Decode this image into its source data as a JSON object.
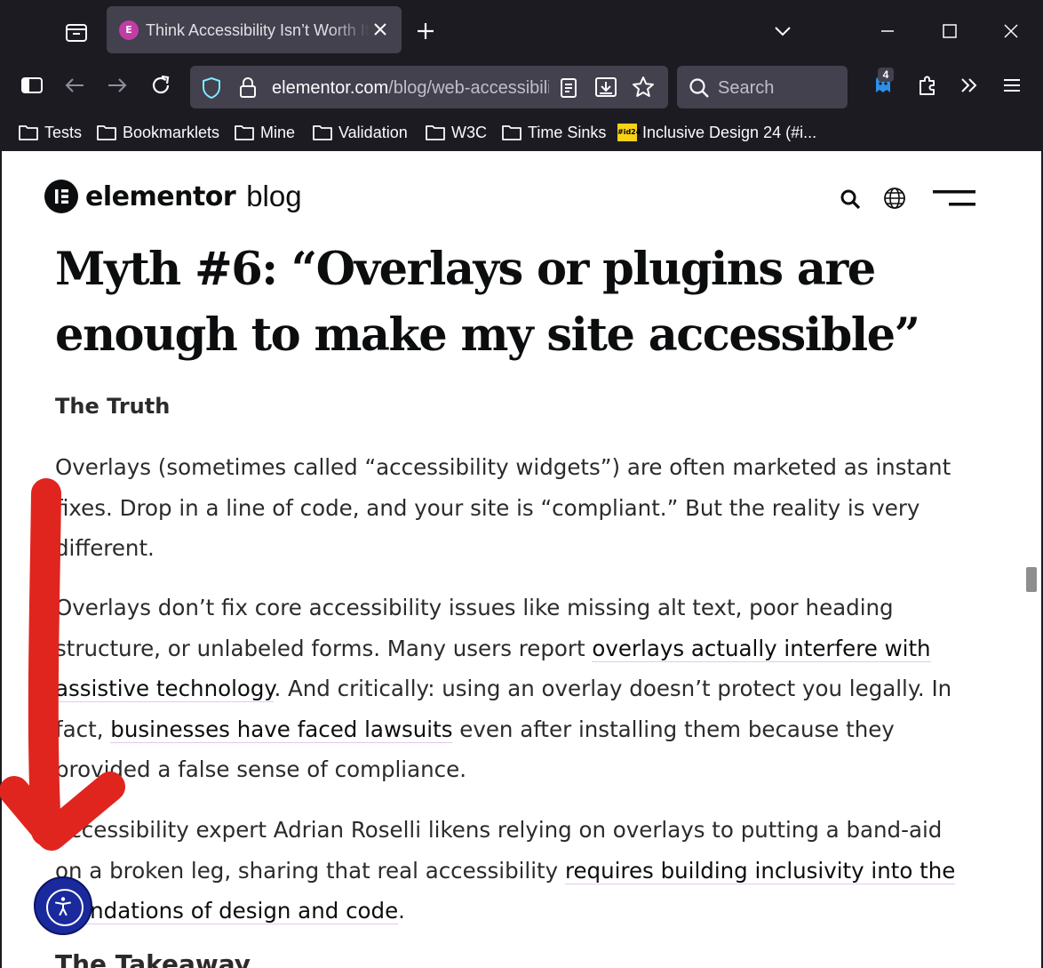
{
  "browser": {
    "tab": {
      "title": "Think Accessibility Isn’t Worth It? Here’s Why You’re Wrong",
      "favicon_glyph": "E"
    },
    "url": {
      "host": "elementor.com",
      "path": "/blog/web-accessibility"
    },
    "search_placeholder": "Search",
    "extension_badge": "4",
    "bookmarks": [
      {
        "label": "Tests",
        "type": "folder"
      },
      {
        "label": "Bookmarklets",
        "type": "folder"
      },
      {
        "label": "Mine",
        "type": "folder"
      },
      {
        "label": "Validation",
        "type": "folder"
      },
      {
        "label": "W3C",
        "type": "folder"
      },
      {
        "label": "Time Sinks",
        "type": "folder"
      },
      {
        "label": "Inclusive Design 24 (#i...",
        "type": "site",
        "favicon_text": "#id24"
      }
    ]
  },
  "site": {
    "logo_name": "elementor",
    "logo_sub": "blog"
  },
  "article": {
    "heading": "Myth #6: “Overlays or plugins are enough to make my site accessible”",
    "subheading": "The Truth",
    "p1": "Overlays (sometimes called “accessibility widgets”) are often marketed as instant fixes. Drop in a line of code, and your site is “compliant.” But the reality is very different.",
    "p2": {
      "t1": "Overlays don’t fix core accessibility issues like missing alt text, poor heading structure, or unlabeled forms. Many users report ",
      "link1": "overlays actually interfere with assistive technology",
      "t2": ". And critically: using an overlay doesn’t protect you legally. In fact, ",
      "link2": "businesses have faced lawsuits",
      "t3": " even after installing them because they provided a false sense of compliance."
    },
    "p3": {
      "t1": "Accessibility expert Adrian Roselli likens relying on overlays to putting a band-aid on a broken leg, sharing that real accessibility ",
      "link1": "requires building inclusivity into the foundations of design and code",
      "t2": "."
    },
    "next_heading_partial": "The Takeaway"
  },
  "colors": {
    "chrome_bg": "#1c1b22",
    "tab_active": "#42414d",
    "link_underline": "#e7c6f0",
    "a11y_widget": "#1a2a9c",
    "annotation_arrow": "#e0251f"
  },
  "annotation": {
    "type": "arrow",
    "direction": "down",
    "points_to": "accessibility-widget-button"
  }
}
